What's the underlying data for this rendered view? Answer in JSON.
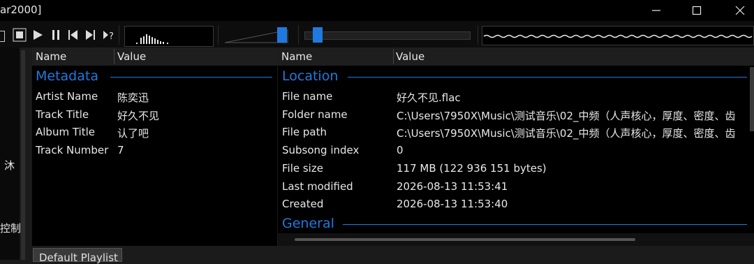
{
  "window": {
    "title": "ar2000]"
  },
  "toolbar": {
    "buttons": [
      "stop-icon",
      "play-icon",
      "pause-icon",
      "previous-icon",
      "next-icon",
      "random-icon"
    ],
    "volume_level": 0.9,
    "seek_position": 0.08
  },
  "sidebar": {
    "chars": [
      "沐",
      "控制"
    ]
  },
  "metadata_panel": {
    "columns": [
      "Name",
      "Value"
    ],
    "group": "Metadata",
    "rows": [
      {
        "name": "Artist Name",
        "value": "陈奕迅"
      },
      {
        "name": "Track Title",
        "value": "好久不见"
      },
      {
        "name": "Album Title",
        "value": "认了吧"
      },
      {
        "name": "Track Number",
        "value": "7"
      }
    ]
  },
  "properties_panel": {
    "columns": [
      "Name",
      "Value"
    ],
    "group_location": "Location",
    "group_general": "General",
    "rows": [
      {
        "name": "File name",
        "value": "好久不见.flac"
      },
      {
        "name": "Folder name",
        "value": "C:\\Users\\7950X\\Music\\测试音乐\\02_中频（人声核心，厚度、密度、齿"
      },
      {
        "name": "File path",
        "value": "C:\\Users\\7950X\\Music\\测试音乐\\02_中频（人声核心，厚度、密度、齿"
      },
      {
        "name": "Subsong index",
        "value": "0"
      },
      {
        "name": "File size",
        "value": "117 MB (122 936 151 bytes)"
      },
      {
        "name": "Last modified",
        "value": "2026-08-13 11:53:41"
      },
      {
        "name": "Created",
        "value": "2026-08-13 11:53:40"
      }
    ]
  },
  "playlist_tab": {
    "label": "Default Playlist"
  }
}
